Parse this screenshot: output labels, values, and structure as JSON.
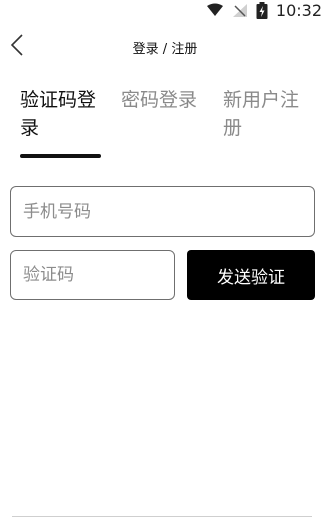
{
  "status_bar": {
    "time": "10:32",
    "icons": [
      "wifi-icon",
      "no-signal-icon",
      "battery-charging-icon"
    ]
  },
  "app_bar": {
    "back_icon": "chevron-left-icon",
    "title": "登录 / 注册"
  },
  "tabs": [
    {
      "label": "验证码登录",
      "active": true
    },
    {
      "label": "密码登录",
      "active": false
    },
    {
      "label": "新用户注册",
      "active": false
    }
  ],
  "form": {
    "phone_placeholder": "手机号码",
    "phone_value": "",
    "code_placeholder": "验证码",
    "code_value": "",
    "send_code_label": "发送验证"
  },
  "colors": {
    "primary": "#000000",
    "inactive_text": "#8a8a8a",
    "input_border": "#6f6f6f"
  }
}
